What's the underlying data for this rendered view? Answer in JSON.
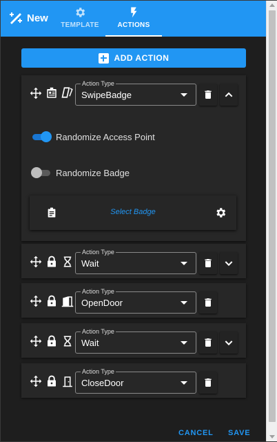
{
  "header": {
    "brand_label": "New",
    "tabs": [
      {
        "label": "TEMPLATE",
        "icon": "gear-icon",
        "active": false
      },
      {
        "label": "ACTIONS",
        "icon": "flash-icon",
        "active": true
      }
    ],
    "color": "#2196f3"
  },
  "add_action_label": "ADD ACTION",
  "actions": [
    {
      "type_legend": "Action Type",
      "type_value": "SwipeBadge",
      "icons": [
        "move-icon",
        "id-card-icon",
        "badge-swipe-icon"
      ],
      "expanded": true,
      "options": [
        {
          "label": "Randomize Access Point",
          "on": true
        },
        {
          "label": "Randomize Badge",
          "on": false
        }
      ],
      "badge_panel": {
        "link_label": "Select Badge",
        "left_icon": "badge-icon",
        "right_icon": "gear-icon"
      }
    },
    {
      "type_legend": "Action Type",
      "type_value": "Wait",
      "icons": [
        "move-icon",
        "lock-icon",
        "hourglass-icon"
      ],
      "expanded": false
    },
    {
      "type_legend": "Action Type",
      "type_value": "OpenDoor",
      "icons": [
        "move-icon",
        "lock-icon",
        "door-open-icon"
      ],
      "expanded": false
    },
    {
      "type_legend": "Action Type",
      "type_value": "Wait",
      "icons": [
        "move-icon",
        "lock-icon",
        "hourglass-icon"
      ],
      "expanded": false
    },
    {
      "type_legend": "Action Type",
      "type_value": "CloseDoor",
      "icons": [
        "move-icon",
        "lock-icon",
        "door-closed-icon"
      ],
      "expanded": false
    }
  ],
  "footer": {
    "cancel_label": "CANCEL",
    "save_label": "SAVE"
  }
}
